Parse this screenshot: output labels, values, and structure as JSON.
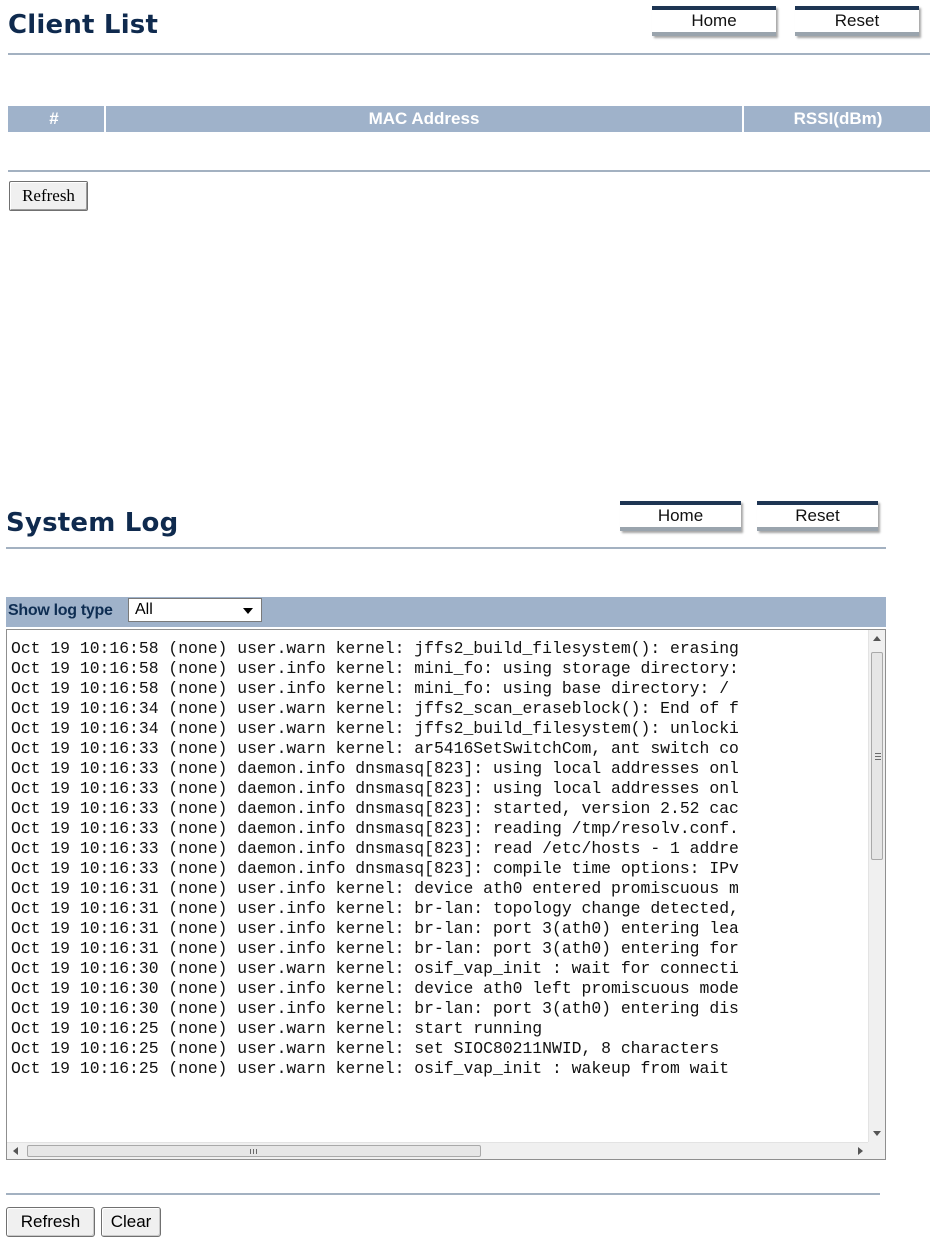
{
  "client_list": {
    "title": "Client List",
    "home_label": "Home",
    "reset_label": "Reset",
    "columns": [
      "#",
      "MAC Address",
      "RSSI(dBm)"
    ],
    "refresh_label": "Refresh"
  },
  "system_log": {
    "title": "System Log",
    "home_label": "Home",
    "reset_label": "Reset",
    "log_type_label": "Show log type",
    "log_type_selected": "All",
    "lines": [
      "Oct 19 10:16:58 (none) user.warn kernel: jffs2_build_filesystem(): erasing",
      "Oct 19 10:16:58 (none) user.info kernel: mini_fo: using storage directory:",
      "Oct 19 10:16:58 (none) user.info kernel: mini_fo: using base directory: /",
      "Oct 19 10:16:34 (none) user.warn kernel: jffs2_scan_eraseblock(): End of f",
      "Oct 19 10:16:34 (none) user.warn kernel: jffs2_build_filesystem(): unlocki",
      "Oct 19 10:16:33 (none) user.warn kernel: ar5416SetSwitchCom, ant switch co",
      "Oct 19 10:16:33 (none) daemon.info dnsmasq[823]: using local addresses onl",
      "Oct 19 10:16:33 (none) daemon.info dnsmasq[823]: using local addresses onl",
      "Oct 19 10:16:33 (none) daemon.info dnsmasq[823]: started, version 2.52 cac",
      "Oct 19 10:16:33 (none) daemon.info dnsmasq[823]: reading /tmp/resolv.conf.",
      "Oct 19 10:16:33 (none) daemon.info dnsmasq[823]: read /etc/hosts - 1 addre",
      "Oct 19 10:16:33 (none) daemon.info dnsmasq[823]: compile time options: IPv",
      "Oct 19 10:16:31 (none) user.info kernel: device ath0 entered promiscuous m",
      "Oct 19 10:16:31 (none) user.info kernel: br-lan: topology change detected,",
      "Oct 19 10:16:31 (none) user.info kernel: br-lan: port 3(ath0) entering lea",
      "Oct 19 10:16:31 (none) user.info kernel: br-lan: port 3(ath0) entering for",
      "Oct 19 10:16:30 (none) user.warn kernel: osif_vap_init : wait for connecti",
      "Oct 19 10:16:30 (none) user.info kernel: device ath0 left promiscuous mode",
      "Oct 19 10:16:30 (none) user.info kernel: br-lan: port 3(ath0) entering dis",
      "Oct 19 10:16:25 (none) user.warn kernel: start running",
      "Oct 19 10:16:25 (none) user.warn kernel: set SIOC80211NWID, 8 characters",
      "Oct 19 10:16:25 (none) user.warn kernel: osif_vap_init : wakeup from wait"
    ],
    "refresh_label": "Refresh",
    "clear_label": "Clear"
  }
}
